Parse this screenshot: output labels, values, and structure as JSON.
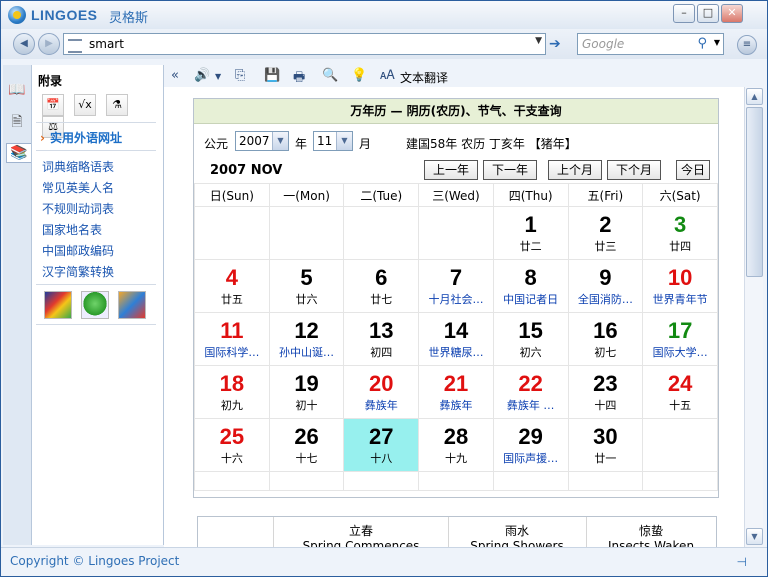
{
  "app": {
    "brand": "LINGOES",
    "brand_cn": "灵格斯"
  },
  "window_buttons": {
    "minimize": "–",
    "maximize": "□",
    "close": "✕"
  },
  "nav": {
    "back": "◀",
    "forward": "▶",
    "address_value": "smart",
    "go": "➔",
    "search_placeholder": "Google",
    "search_icon": "⚲",
    "menu": "≡"
  },
  "sidebar": {
    "title": "附录",
    "tools": [
      "📅",
      "√x",
      "⚗",
      "⚖"
    ],
    "active_item": "实用外语网址",
    "links": [
      "词典缩略语表",
      "常见英美人名",
      "不规则动词表",
      "国家地名表",
      "中国邮政编码",
      "汉字简繁转换"
    ]
  },
  "toolbar": {
    "collapse": "«",
    "speaker": "🔊",
    "copy": "⎘",
    "save": "💾",
    "print": "🖶",
    "find": "🔍",
    "tip": "💡",
    "translate_label": "文本翻译"
  },
  "calendar": {
    "title": "万年历 — 阴历(农历)、节气、干支查询",
    "era_label": "公元",
    "year": "2007",
    "year_label": "年",
    "month": "11",
    "month_label": "月",
    "info": "建国58年 农历 丁亥年 【猪年】",
    "ym": "2007 NOV",
    "buttons": [
      "上一年",
      "下一年",
      "上个月",
      "下个月",
      "今日"
    ],
    "weekdays": [
      "日(Sun)",
      "一(Mon)",
      "二(Tue)",
      "三(Wed)",
      "四(Thu)",
      "五(Fri)",
      "六(Sat)"
    ],
    "weeks": [
      [
        null,
        null,
        null,
        null,
        {
          "d": "1",
          "l": "廿二",
          "dc": "black",
          "lc": "black"
        },
        {
          "d": "2",
          "l": "廿三",
          "dc": "black",
          "lc": "black"
        },
        {
          "d": "3",
          "l": "廿四",
          "dc": "green",
          "lc": "black"
        }
      ],
      [
        {
          "d": "4",
          "l": "廿五",
          "dc": "red",
          "lc": "black"
        },
        {
          "d": "5",
          "l": "廿六",
          "dc": "black",
          "lc": "black"
        },
        {
          "d": "6",
          "l": "廿七",
          "dc": "black",
          "lc": "black"
        },
        {
          "d": "7",
          "l": "十月社会…",
          "dc": "black",
          "lc": "blue"
        },
        {
          "d": "8",
          "l": "中国记者日",
          "dc": "black",
          "lc": "blue"
        },
        {
          "d": "9",
          "l": "全国消防…",
          "dc": "black",
          "lc": "blue"
        },
        {
          "d": "10",
          "l": "世界青年节",
          "dc": "red",
          "lc": "blue"
        }
      ],
      [
        {
          "d": "11",
          "l": "国际科学…",
          "dc": "red",
          "lc": "blue"
        },
        {
          "d": "12",
          "l": "孙中山诞…",
          "dc": "black",
          "lc": "blue"
        },
        {
          "d": "13",
          "l": "初四",
          "dc": "black",
          "lc": "black"
        },
        {
          "d": "14",
          "l": "世界糖尿…",
          "dc": "black",
          "lc": "blue"
        },
        {
          "d": "15",
          "l": "初六",
          "dc": "black",
          "lc": "black"
        },
        {
          "d": "16",
          "l": "初七",
          "dc": "black",
          "lc": "black"
        },
        {
          "d": "17",
          "l": "国际大学…",
          "dc": "green",
          "lc": "blue"
        }
      ],
      [
        {
          "d": "18",
          "l": "初九",
          "dc": "red",
          "lc": "black"
        },
        {
          "d": "19",
          "l": "初十",
          "dc": "black",
          "lc": "black"
        },
        {
          "d": "20",
          "l": "彝族年",
          "dc": "red",
          "lc": "blue"
        },
        {
          "d": "21",
          "l": "彝族年",
          "dc": "red",
          "lc": "blue"
        },
        {
          "d": "22",
          "l": "彝族年 …",
          "dc": "red",
          "lc": "blue"
        },
        {
          "d": "23",
          "l": "十四",
          "dc": "black",
          "lc": "black"
        },
        {
          "d": "24",
          "l": "十五",
          "dc": "red",
          "lc": "black"
        }
      ],
      [
        {
          "d": "25",
          "l": "十六",
          "dc": "red",
          "lc": "black"
        },
        {
          "d": "26",
          "l": "十七",
          "dc": "black",
          "lc": "black"
        },
        {
          "d": "27",
          "l": "十八",
          "dc": "black",
          "lc": "black",
          "today": true
        },
        {
          "d": "28",
          "l": "十九",
          "dc": "black",
          "lc": "black"
        },
        {
          "d": "29",
          "l": "国际声援…",
          "dc": "black",
          "lc": "blue"
        },
        {
          "d": "30",
          "l": "廿一",
          "dc": "black",
          "lc": "black"
        },
        null
      ]
    ]
  },
  "solar_terms": [
    {
      "cn": "立春",
      "en": "Spring Commences"
    },
    {
      "cn": "雨水",
      "en": "Spring Showers"
    },
    {
      "cn": "惊蛰",
      "en": "Insects Waken"
    }
  ],
  "status": {
    "copyright": "Copyright © Lingoes Project",
    "pin": "⊣"
  },
  "scroll": {
    "up": "▲",
    "down": "▼"
  }
}
